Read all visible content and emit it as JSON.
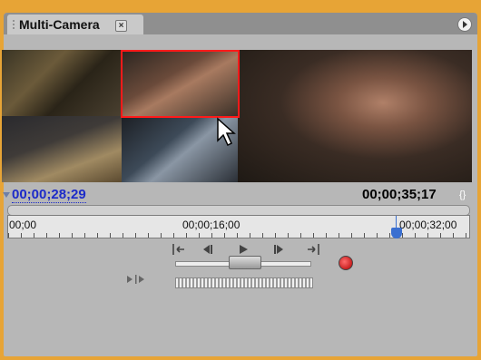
{
  "panel": {
    "tab_label": "Multi-Camera",
    "tab_close_glyph": "×"
  },
  "timecode": {
    "current": "00;00;28;29",
    "duration": "00;00;35;17",
    "duration_icon": "{}"
  },
  "ruler": {
    "labels": [
      "00;00",
      "00;00;16;00",
      "00;00;32;00"
    ]
  },
  "controls": {
    "icons": [
      "go-to-in-point-icon",
      "step-back-icon",
      "play-icon",
      "step-forward-icon",
      "go-to-out-point-icon"
    ],
    "record_color": "#c00000"
  },
  "colors": {
    "selection_border": "#ff1a1a",
    "current_timecode": "#1c2bc9",
    "playhead": "#3a6fd0",
    "frame": "#e7a436"
  }
}
